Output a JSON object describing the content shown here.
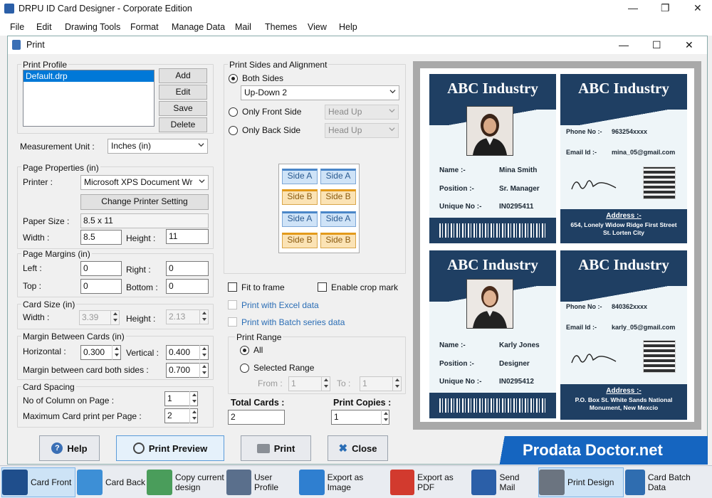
{
  "app": {
    "title": "DRPU ID Card Designer - Corporate Edition"
  },
  "menu": [
    "File",
    "Edit",
    "Drawing Tools",
    "Format",
    "Manage Data",
    "Mail",
    "Themes",
    "View",
    "Help"
  ],
  "dialog": {
    "title": "Print"
  },
  "print_profile": {
    "label": "Print Profile",
    "items": [
      "Default.drp"
    ],
    "add": "Add",
    "edit": "Edit",
    "save": "Save",
    "delete": "Delete"
  },
  "measurement": {
    "label": "Measurement Unit :",
    "value": "Inches (in)"
  },
  "page_properties": {
    "label": "Page Properties (in)",
    "printer_label": "Printer :",
    "printer_value": "Microsoft XPS Document Wr",
    "change_printer": "Change Printer Setting",
    "paper_size_label": "Paper Size :",
    "paper_size": "8.5 x 11",
    "width_label": "Width :",
    "width": "8.5",
    "height_label": "Height :",
    "height": "11"
  },
  "page_margins": {
    "label": "Page Margins (in)",
    "left_label": "Left :",
    "left": "0",
    "right_label": "Right :",
    "right": "0",
    "top_label": "Top :",
    "top": "0",
    "bottom_label": "Bottom :",
    "bottom": "0"
  },
  "card_size": {
    "label": "Card Size (in)",
    "width_label": "Width :",
    "width": "3.39",
    "height_label": "Height :",
    "height": "2.13"
  },
  "margin_between": {
    "label": "Margin Between Cards (in)",
    "horizontal_label": "Horizontal :",
    "horizontal": "0.300",
    "vertical_label": "Vertical :",
    "vertical": "0.400",
    "both_label": "Margin between card both sides :",
    "both": "0.700"
  },
  "card_spacing": {
    "label": "Card Spacing",
    "columns_label": "No of Column on Page :",
    "columns": "1",
    "max_label": "Maximum Card print per Page :",
    "max": "2"
  },
  "sides": {
    "label": "Print Sides and Alignment",
    "both": "Both Sides",
    "both_value": "Up-Down 2",
    "front": "Only Front Side",
    "front_value": "Head Up",
    "back": "Only Back Side",
    "back_value": "Head Up",
    "side_a": "Side A",
    "side_b": "Side B"
  },
  "options": {
    "fit": "Fit to frame",
    "crop": "Enable crop mark",
    "excel": "Print with Excel data",
    "batch": "Print with Batch series data"
  },
  "print_range": {
    "label": "Print Range",
    "all": "All",
    "selected": "Selected Range",
    "from_label": "From :",
    "from": "1",
    "to_label": "To :",
    "to": "1"
  },
  "totals": {
    "cards_label": "Total Cards :",
    "cards": "2",
    "copies_label": "Print Copies :",
    "copies": "1"
  },
  "buttons": {
    "help": "Help",
    "preview": "Print Preview",
    "print": "Print",
    "close": "Close"
  },
  "brand": "Prodata Doctor.net",
  "taskbar": [
    "Card Front",
    "Card Back",
    "Copy current design",
    "User Profile",
    "Export as Image",
    "Export as PDF",
    "Send Mail",
    "Print Design",
    "Card Batch Data"
  ],
  "cards": [
    {
      "company": "ABC Industry",
      "name_label": "Name :-",
      "name": "Mina Smith",
      "position_label": "Position :-",
      "position": "Sr. Manager",
      "unique_label": "Unique No :-",
      "unique": "IN0295411",
      "phone_label": "Phone No :-",
      "phone": "963254xxxx",
      "email_label": "Email Id :-",
      "email": "mina_05@gmail.com",
      "address_label": "Address :-",
      "address1": "654, Lonely Widow Ridge First Street",
      "address2": "St. Lorten City"
    },
    {
      "company": "ABC Industry",
      "name_label": "Name :-",
      "name": "Karly Jones",
      "position_label": "Position :-",
      "position": "Designer",
      "unique_label": "Unique No :-",
      "unique": "IN0295412",
      "phone_label": "Phone No :-",
      "phone": "840362xxxx",
      "email_label": "Email Id :-",
      "email": "karly_05@gmail.com",
      "address_label": "Address :-",
      "address1": "P.O. Box St. White Sands National",
      "address2": "Monument, New Mexcio"
    }
  ],
  "colors": {
    "card_navy": "#1f3f63",
    "accent": "#0078d7",
    "brand_blue": "#1565c0"
  }
}
